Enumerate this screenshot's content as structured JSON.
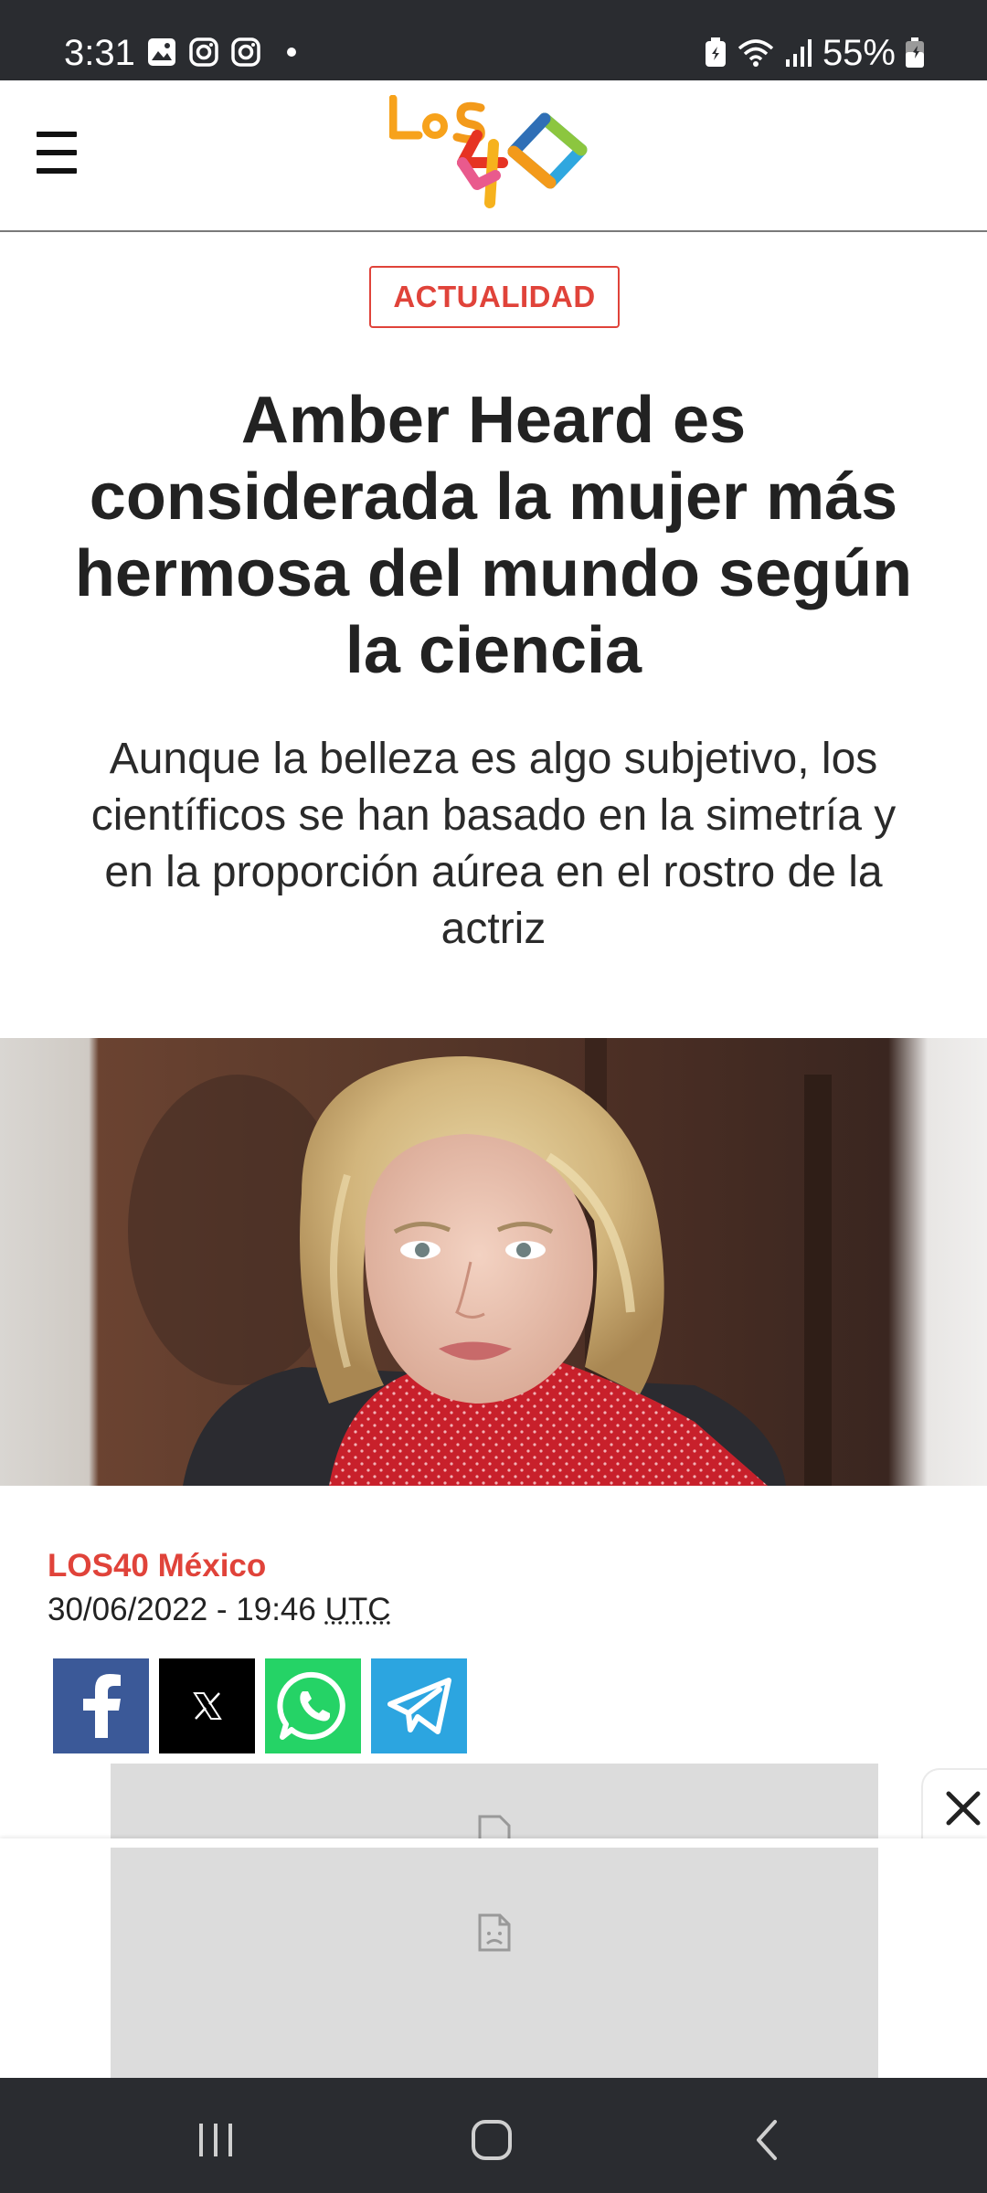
{
  "status_bar": {
    "time": "3:31",
    "battery_percent": "55%",
    "left_icons": [
      "gallery-icon",
      "instagram-icon",
      "instagram-icon",
      "dot-icon"
    ],
    "right_icons": [
      "battery-saver-icon",
      "wifi-icon",
      "signal-icon",
      "battery-icon"
    ]
  },
  "header": {
    "menu_icon": "hamburger-menu-icon",
    "logo_text": "LOS40"
  },
  "article": {
    "category": "ACTUALIDAD",
    "headline_lines": [
      "Amber Heard es",
      "considerada la mujer más",
      "hermosa del mundo según",
      "la ciencia"
    ],
    "subheadline_lines": [
      "Aunque la belleza es algo subjetivo, los",
      "científicos se han basado en la simetría y",
      "en la proporción aúrea en el rostro de la",
      "actriz"
    ],
    "source": "LOS40 México",
    "date": "30/06/2022 - 19:46 ",
    "timezone": "UTC"
  },
  "share": [
    {
      "name": "facebook",
      "icon": "facebook-icon",
      "color": "#3b5998"
    },
    {
      "name": "x",
      "icon": "x-icon",
      "color": "#000000"
    },
    {
      "name": "whatsapp",
      "icon": "whatsapp-icon",
      "color": "#25d366"
    },
    {
      "name": "telegram",
      "icon": "telegram-icon",
      "color": "#2ca5e0"
    }
  ],
  "colors": {
    "accent": "#e0433a",
    "text": "#222222",
    "system_bar": "#2a2c30"
  },
  "nav_bar": {
    "icons": [
      "recent-apps-icon",
      "home-icon",
      "back-icon"
    ]
  }
}
